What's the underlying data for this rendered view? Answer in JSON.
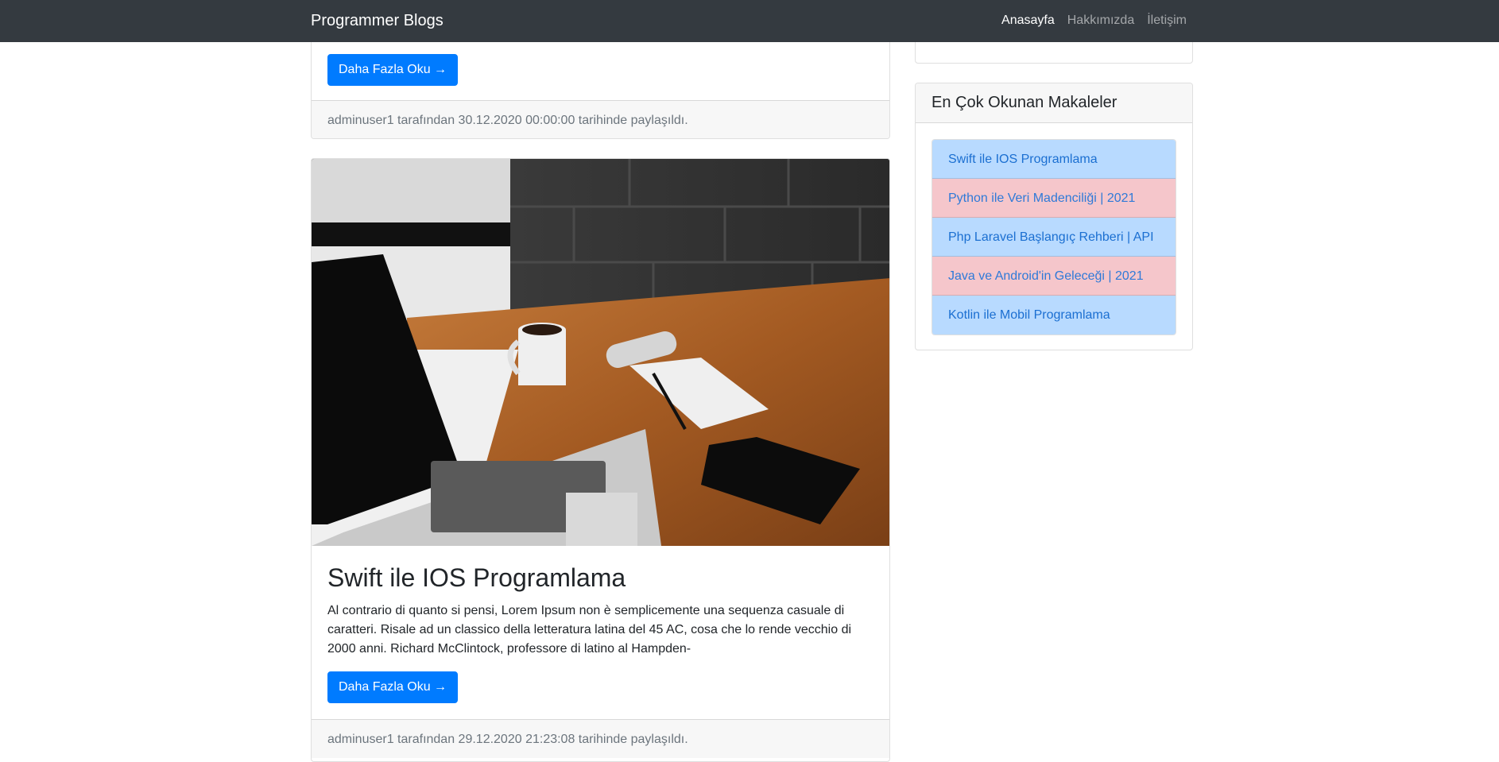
{
  "navbar": {
    "brand": "Programmer Blogs",
    "links": [
      "Anasayfa",
      "Hakkımızda",
      "İletişim"
    ]
  },
  "posts": [
    {
      "read_more": "Daha Fazla Oku →",
      "footer": "adminuser1 tarafından 30.12.2020 00:00:00 tarihinde paylaşıldı."
    },
    {
      "title": "Swift ile IOS Programlama",
      "excerpt": "Al contrario di quanto si pensi, Lorem Ipsum non è semplicemente una sequenza casuale di caratteri. Risale ad un classico della letteratura latina del 45 AC, cosa che lo rende vecchio di 2000 anni. Richard McClintock, professore di latino al Hampden-",
      "read_more": "Daha Fazla Oku →",
      "footer": "adminuser1 tarafından 29.12.2020 21:23:08 tarihinde paylaşıldı."
    }
  ],
  "sidebar": {
    "popular_title": "En Çok Okunan Makaleler",
    "popular": [
      "Swift ile IOS Programlama",
      "Python ile Veri Madenciliği | 2021",
      "Php Laravel Başlangıç Rehberi | API",
      "Java ve Android'in Geleceği | 2021",
      "Kotlin ile Mobil Programlama"
    ]
  },
  "colors": {
    "navbar": "#343a40",
    "primary": "#007bff",
    "list_blue": "#b8daff",
    "list_red": "#f5c6cb"
  }
}
